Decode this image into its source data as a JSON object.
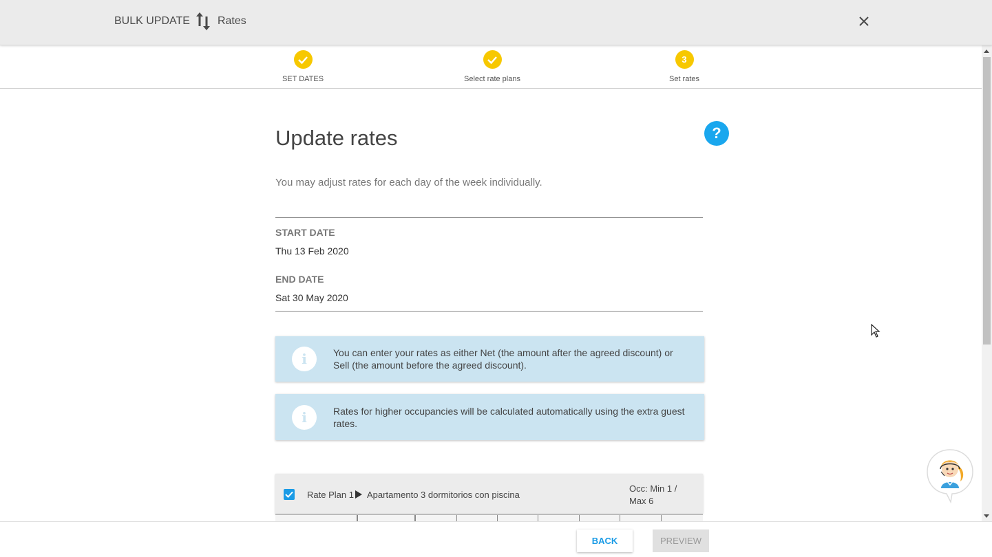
{
  "header": {
    "bulk_label": "BULK UPDATE",
    "section_label": "Rates",
    "swap_icon": "swap-vertical-icon",
    "close_icon": "close-icon"
  },
  "stepper": {
    "steps": [
      {
        "label": "SET DATES",
        "state": "complete"
      },
      {
        "label": "Select rate plans",
        "state": "complete"
      },
      {
        "label": "Set rates",
        "state": "active",
        "number": "3"
      }
    ],
    "accent_color": "#f7c800"
  },
  "main": {
    "title": "Update rates",
    "help_label": "?",
    "subtitle": "You may adjust rates for each day of the week individually.",
    "start_date_label": "START DATE",
    "start_date_value": "Thu 13 Feb 2020",
    "end_date_label": "END DATE",
    "end_date_value": "Sat 30 May 2020"
  },
  "info_boxes": [
    {
      "icon": "info-icon",
      "text": "You can enter your rates as either Net (the amount after the agreed discount) or Sell (the amount before the agreed discount)."
    },
    {
      "icon": "info-icon",
      "text": "Rates for higher occupancies will be calculated automatically using the extra guest rates."
    }
  ],
  "rate_plan": {
    "checked": true,
    "name": "Rate Plan 1",
    "room": "Apartamento 3 dormitorios con piscina",
    "occupancy": "Occ: Min 1 / Max 6"
  },
  "footer": {
    "back_label": "BACK",
    "preview_label": "PREVIEW"
  },
  "colors": {
    "link_blue": "#1a9be6",
    "info_bg": "#cbe4f1"
  }
}
